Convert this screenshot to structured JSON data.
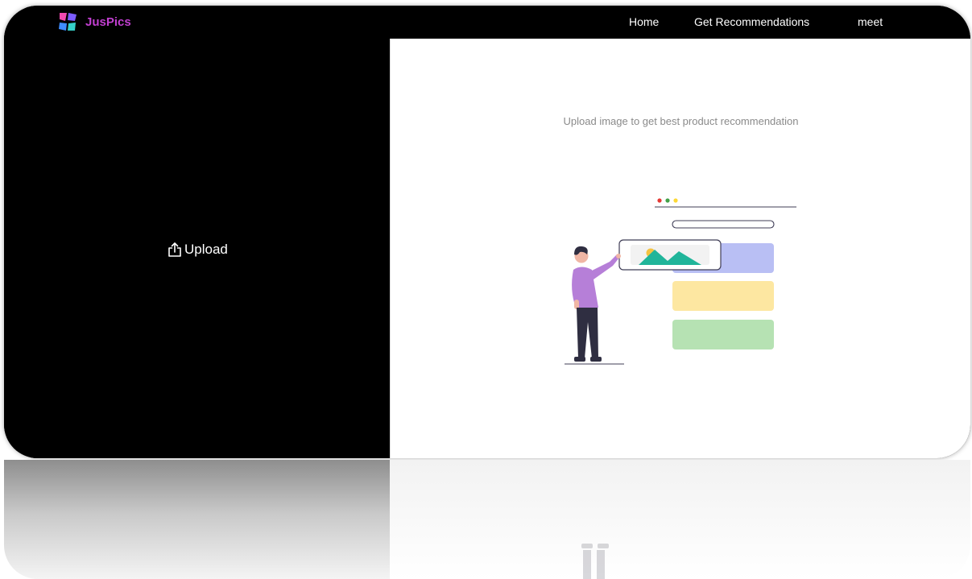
{
  "brand": {
    "name": "JusPics",
    "color": "#c23fd1"
  },
  "nav": {
    "items": [
      "Home",
      "Get Recommendations",
      "meet"
    ]
  },
  "upload": {
    "label": "Upload",
    "icon": "upload-icon"
  },
  "main": {
    "heading": "Upload image to get best product recommendation"
  },
  "colors": {
    "left_panel": "#000000",
    "right_panel": "#ffffff",
    "card_blue": "#b9bff4",
    "card_yellow": "#fde7a1",
    "card_green": "#b6e2b3",
    "mountain": "#20b59a",
    "sun": "#f5c342",
    "shirt": "#b67fd8"
  }
}
